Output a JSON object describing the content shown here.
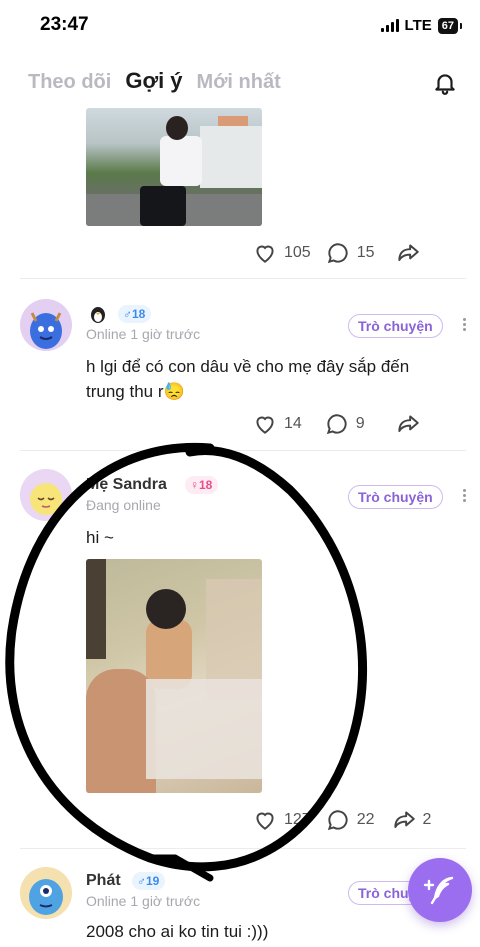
{
  "status_bar": {
    "time": "23:47",
    "network": "LTE",
    "battery": "67"
  },
  "tabs": [
    {
      "label": "Theo dõi",
      "active": false
    },
    {
      "label": "Gợi ý",
      "active": true
    },
    {
      "label": "Mới nhất",
      "active": false
    }
  ],
  "post_top": {
    "likes": "105",
    "comments": "15"
  },
  "post_2": {
    "age": "18",
    "gender": "male",
    "status": "Online 1 giờ trước",
    "chat_label": "Trò chuyện",
    "text": "h lgi để có con dâu về cho mẹ đây sắp đến trung thu r😓",
    "likes": "14",
    "comments": "9"
  },
  "post_3": {
    "username": "Mẹ Sandra",
    "age": "18",
    "gender": "female",
    "status": "Đang online",
    "chat_label": "Trò chuyện",
    "text": "hi ~",
    "likes": "127",
    "comments": "22",
    "shares": "2"
  },
  "post_4": {
    "username": "Phát",
    "age": "19",
    "gender": "male",
    "status": "Online 1 giờ trước",
    "chat_label": "Trò chuyện",
    "text": "2008 cho ai ko tin tui :)))"
  },
  "colors": {
    "accent": "#9b6ef0",
    "male": "#3d8be8",
    "female": "#ea4d8c"
  }
}
